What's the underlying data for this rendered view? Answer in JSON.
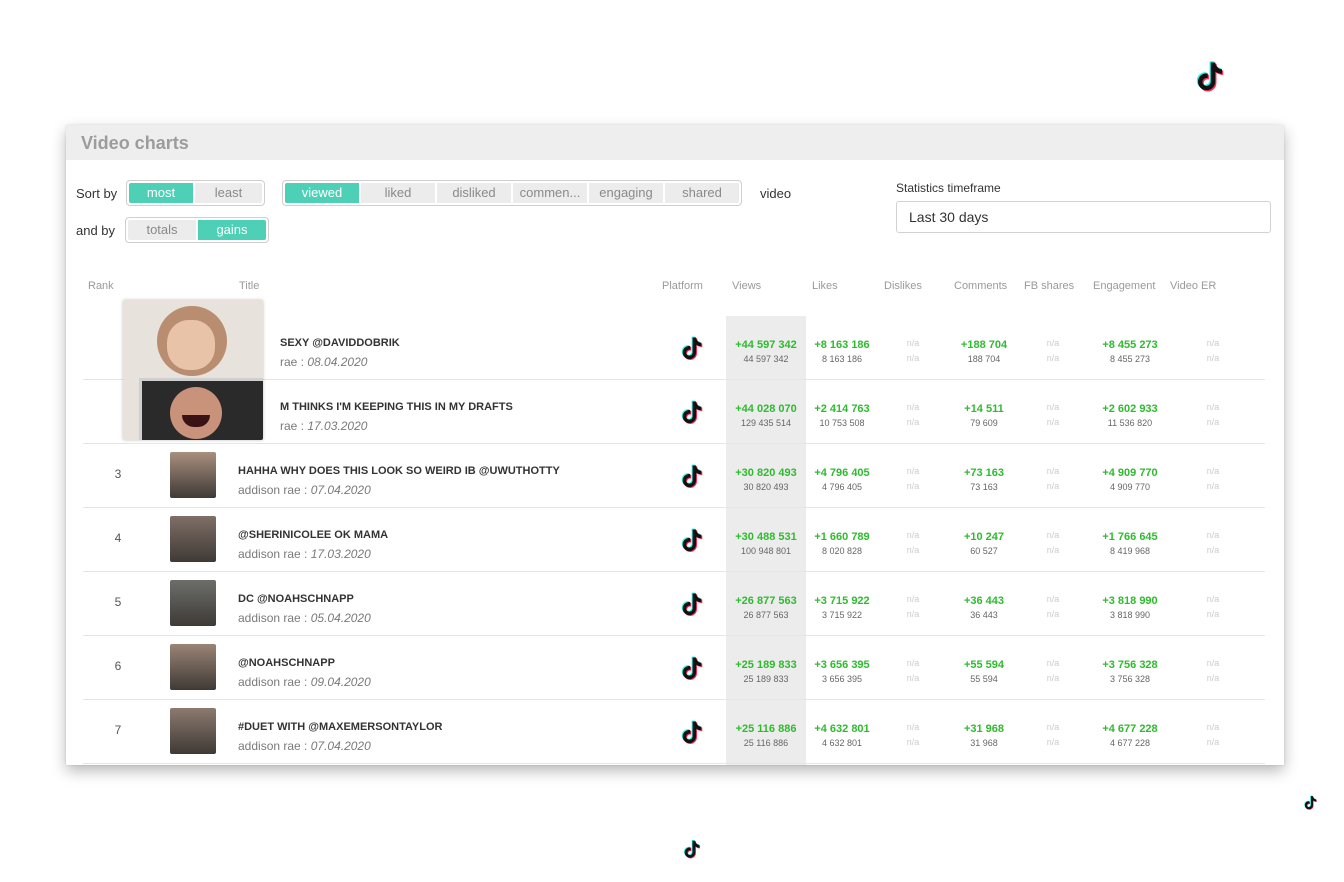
{
  "app": {
    "title": "Video charts"
  },
  "sort": {
    "label": "Sort by",
    "order_options": [
      "most",
      "least"
    ],
    "order_selected": "most",
    "metric_options": [
      "viewed",
      "liked",
      "disliked",
      "commen...",
      "engaging",
      "shared"
    ],
    "metric_selected": "viewed",
    "suffix": "video"
  },
  "andby": {
    "label": "and by",
    "options": [
      "totals",
      "gains"
    ],
    "selected": "gains"
  },
  "timeframe": {
    "label": "Statistics timeframe",
    "value": "Last 30 days"
  },
  "columns": {
    "rank": "Rank",
    "title": "Title",
    "platform": "Platform",
    "views": "Views",
    "likes": "Likes",
    "dislikes": "Dislikes",
    "comments": "Comments",
    "fb_shares": "FB shares",
    "engagement": "Engagement",
    "video_er": "Video ER"
  },
  "na": "n/a",
  "rows": [
    {
      "rank": "",
      "title": "SEXY @DAVIDDOBRIK",
      "author": "rae : ",
      "date": "08.04.2020",
      "views_gain": "+44 597 342",
      "views_total": "44 597 342",
      "likes_gain": "+8 163 186",
      "likes_total": "8 163 186",
      "comments_gain": "+188 704",
      "comments_total": "188 704",
      "eng_gain": "+8 455 273",
      "eng_total": "8 455 273"
    },
    {
      "rank": "",
      "title": "M THINKS I'M KEEPING THIS IN MY DRAFTS",
      "author": "rae : ",
      "date": "17.03.2020",
      "views_gain": "+44 028 070",
      "views_total": "129 435 514",
      "likes_gain": "+2 414 763",
      "likes_total": "10 753 508",
      "comments_gain": "+14 511",
      "comments_total": "79 609",
      "eng_gain": "+2 602 933",
      "eng_total": "11 536 820"
    },
    {
      "rank": "3",
      "title": "HAHHA WHY DOES THIS LOOK SO WEIRD IB @UWUTHOTTY",
      "author": "addison rae : ",
      "date": "07.04.2020",
      "views_gain": "+30 820 493",
      "views_total": "30 820 493",
      "likes_gain": "+4 796 405",
      "likes_total": "4 796 405",
      "comments_gain": "+73 163",
      "comments_total": "73 163",
      "eng_gain": "+4 909 770",
      "eng_total": "4 909 770"
    },
    {
      "rank": "4",
      "title": "@SHERINICOLEE OK MAMA",
      "author": "addison rae : ",
      "date": "17.03.2020",
      "views_gain": "+30 488 531",
      "views_total": "100 948 801",
      "likes_gain": "+1 660 789",
      "likes_total": "8 020 828",
      "comments_gain": "+10 247",
      "comments_total": "60 527",
      "eng_gain": "+1 766 645",
      "eng_total": "8 419 968"
    },
    {
      "rank": "5",
      "title": "DC @NOAHSCHNAPP",
      "author": "addison rae : ",
      "date": "05.04.2020",
      "views_gain": "+26 877 563",
      "views_total": "26 877 563",
      "likes_gain": "+3 715 922",
      "likes_total": "3 715 922",
      "comments_gain": "+36 443",
      "comments_total": "36 443",
      "eng_gain": "+3 818 990",
      "eng_total": "3 818 990"
    },
    {
      "rank": "6",
      "title": "@NOAHSCHNAPP",
      "author": "addison rae : ",
      "date": "09.04.2020",
      "views_gain": "+25 189 833",
      "views_total": "25 189 833",
      "likes_gain": "+3 656 395",
      "likes_total": "3 656 395",
      "comments_gain": "+55 594",
      "comments_total": "55 594",
      "eng_gain": "+3 756 328",
      "eng_total": "3 756 328"
    },
    {
      "rank": "7",
      "title": "#DUET WITH @MAXEMERSONTAYLOR",
      "author": "addison rae : ",
      "date": "07.04.2020",
      "views_gain": "+25 116 886",
      "views_total": "25 116 886",
      "likes_gain": "+4 632 801",
      "likes_total": "4 632 801",
      "comments_gain": "+31 968",
      "comments_total": "31 968",
      "eng_gain": "+4 677 228",
      "eng_total": "4 677 228"
    }
  ],
  "icons": {
    "platform": "tiktok-icon"
  },
  "colors": {
    "accent": "#4dd0b5",
    "gain": "#2ebb2e",
    "na": "#cccccc",
    "header_bg": "#eeeeee"
  }
}
